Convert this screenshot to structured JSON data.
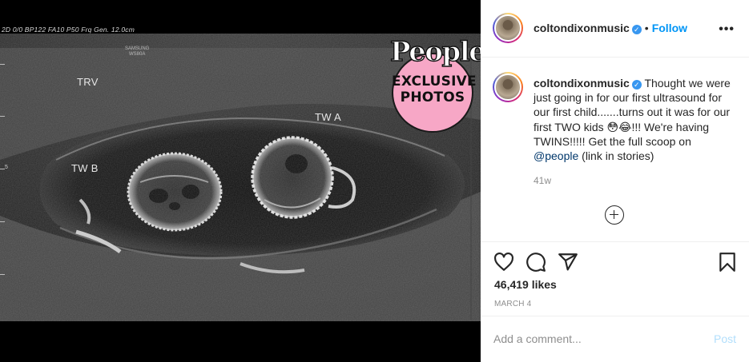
{
  "ultrasound": {
    "header_text": "2D 0/0 BP122 FA10 P50 Frq Gen. 12.0cm",
    "brand_line1": "SAMSUNG",
    "brand_line2": "WS80A",
    "label_trv": "TRV",
    "label_twa": "TW A",
    "label_twb": "TW B",
    "scale_mark": "5"
  },
  "badge": {
    "brand": "People",
    "line1": "EXCLUSIVE",
    "line2": "PHOTOS",
    "color": "#f7a7c6"
  },
  "post": {
    "username": "coltondixonmusic",
    "verified": true,
    "follow_label": "Follow",
    "more_icon": "more-horizontal-icon",
    "caption_part1": "Thought we were just going in for our first ultrasound for our first child.......turns out it was for our first TWO kids 😳😂!!! We're having TWINS!!!!! Get the full scoop on ",
    "mention": "@people",
    "caption_part2": " (link in stories)",
    "time_ago": "41w",
    "likes": "46,419 likes",
    "date": "MARCH 4"
  },
  "comment": {
    "placeholder": "Add a comment...",
    "post_label": "Post"
  },
  "colors": {
    "accent": "#0095f6",
    "text": "#262626",
    "muted": "#8e8e8e",
    "post_disabled": "#b2dffc"
  }
}
